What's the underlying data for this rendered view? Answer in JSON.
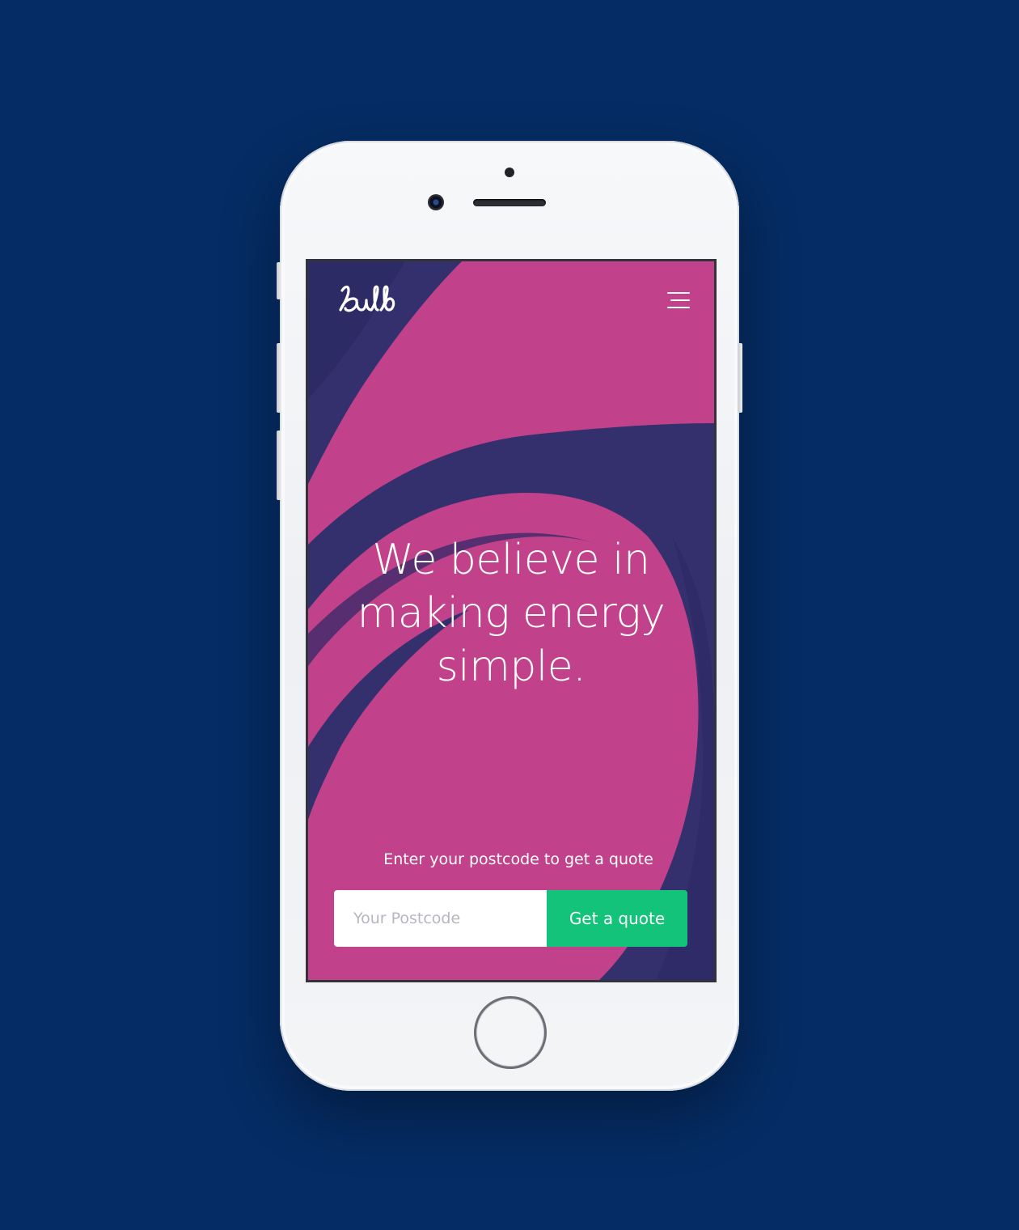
{
  "brand": {
    "logo_text": "bulb"
  },
  "hero": {
    "headline": "We believe in making energy simple.",
    "prompt": "Enter your postcode to get a quote"
  },
  "quote_form": {
    "postcode_placeholder": "Your Postcode",
    "postcode_value": "",
    "submit_label": "Get a quote"
  },
  "nav": {
    "menu_icon": "hamburger-menu-icon"
  },
  "colors": {
    "page_background": "#052c64",
    "hero_pink": "#c1428a",
    "hero_navy": "#34306e",
    "cta_green": "#13c37a"
  }
}
